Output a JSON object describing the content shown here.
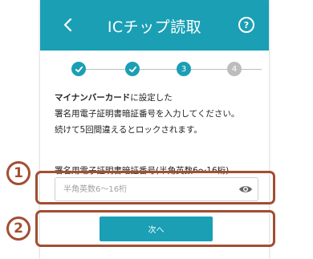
{
  "header": {
    "title": "ICチップ読取",
    "back_icon": "‹",
    "help_icon": "?"
  },
  "steps": [
    {
      "label": "",
      "state": "done"
    },
    {
      "label": "",
      "state": "done"
    },
    {
      "label": "3",
      "state": "current"
    },
    {
      "label": "4",
      "state": "todo"
    }
  ],
  "instructions": {
    "line1_bold": "マイナンバーカード",
    "line1_rest": "に設定した",
    "line2": "署名用電子証明書暗証番号を入力してください。",
    "line3": "続けて5回間違えるとロックされます。"
  },
  "pin_field": {
    "label": "署名用電子証明書暗証番号(半角英数6～16桁)",
    "placeholder": "半角英数6～16桁",
    "value": ""
  },
  "next_button": {
    "label": "次へ"
  },
  "annotations": {
    "marker1": "1",
    "marker2": "2"
  },
  "colors": {
    "accent": "#1a9fb5",
    "annotation": "#a24e32",
    "inactive_step": "#bdbdbd"
  }
}
